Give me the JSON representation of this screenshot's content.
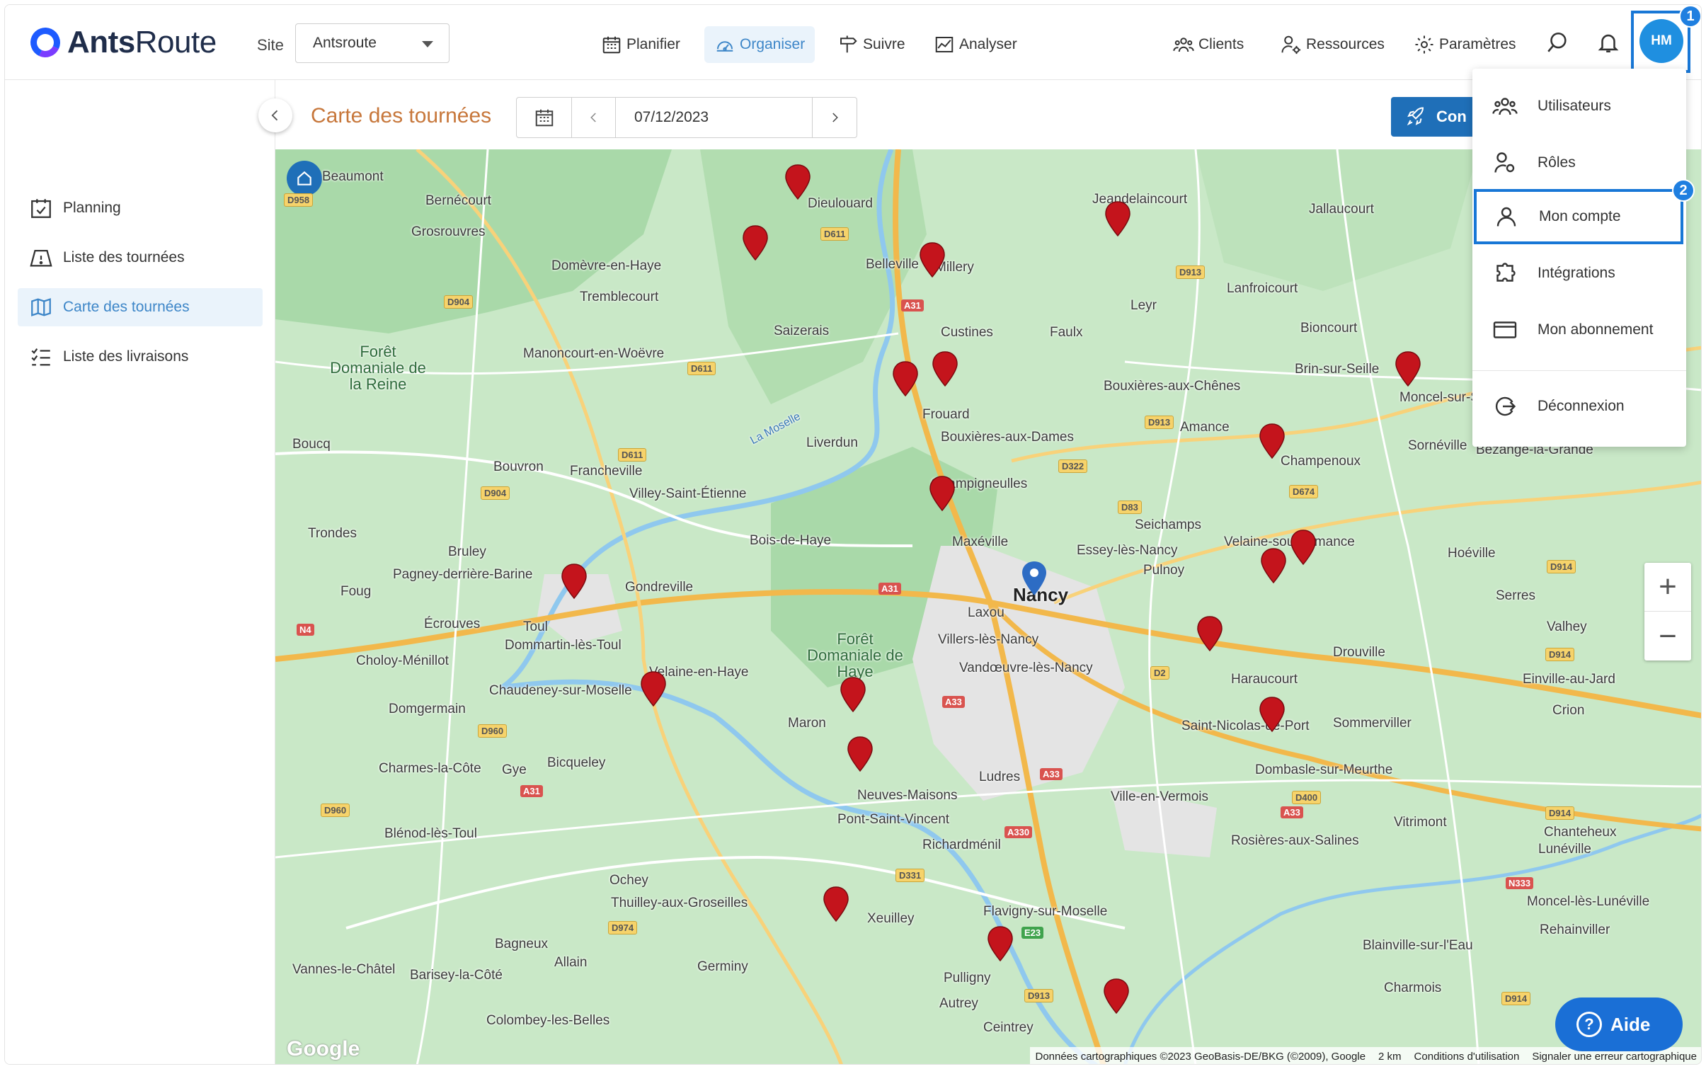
{
  "header": {
    "brand_bold": "Ants",
    "brand_light": "Route",
    "site_label": "Site",
    "site_value": "Antsroute",
    "nav": [
      {
        "label": "Planifier"
      },
      {
        "label": "Organiser"
      },
      {
        "label": "Suivre"
      },
      {
        "label": "Analyser"
      },
      {
        "label": "Clients"
      },
      {
        "label": "Ressources"
      },
      {
        "label": "Paramètres"
      }
    ],
    "avatar_initials": "HM",
    "step_1": "1",
    "step_2": "2"
  },
  "sidebar": {
    "items": [
      {
        "label": "Planning",
        "icon": "calendar-check-icon"
      },
      {
        "label": "Liste des tournées",
        "icon": "tent-icon"
      },
      {
        "label": "Carte des tournées",
        "icon": "map-icon"
      },
      {
        "label": "Liste des livraisons",
        "icon": "checklist-icon"
      }
    ]
  },
  "toolbar": {
    "page_title": "Carte des tournées",
    "date": "07/12/2023",
    "primary_button": "Con"
  },
  "dropdown": {
    "items": [
      {
        "label": "Utilisateurs"
      },
      {
        "label": "Rôles"
      },
      {
        "label": "Mon compte"
      },
      {
        "label": "Intégrations"
      },
      {
        "label": "Mon abonnement"
      },
      {
        "label": "Déconnexion"
      }
    ]
  },
  "map": {
    "places": [
      "Beaumont",
      "Bernécourt",
      "Grosrouvres",
      "Dieulouard",
      "Jeandelaincourt",
      "Jallaucourt",
      "Belleville",
      "Millery",
      "Domèvre-en-Haye",
      "Tremblecourt",
      "Leyr",
      "Lanfroicourt",
      "Saizerais",
      "Custines",
      "Faulx",
      "Bioncourt",
      "Manoncourt-en-Woëvre",
      "Brin-sur-Seille",
      "Moncel-sur-Seille",
      "Frouard",
      "Bouxières-aux-Chênes",
      "Liverdun",
      "Bouxières-aux-Dames",
      "Amance",
      "Sornéville",
      "Bezange-la-Grande",
      "Champigneulles",
      "Champenoux",
      "Bouvron",
      "Francheville",
      "Villey-Saint-Étienne",
      "Seichamps",
      "Bois-de-Haye",
      "Maxéville",
      "Essey-lès-Nancy",
      "Velaine-sous-Amance",
      "Hoéville",
      "Trondes",
      "Bruley",
      "Pulnoy",
      "Pagney-derrière-Barine",
      "Gondreville",
      "Nancy",
      "Foug",
      "Laxou",
      "Serres",
      "Écrouves",
      "Toul",
      "Villers-lès-Nancy",
      "Valhey",
      "Dommartin-lès-Toul",
      "Drouville",
      "Choloy-Ménillot",
      "Velaine-en-Haye",
      "Vandœuvre-lès-Nancy",
      "Haraucourt",
      "Einville-au-Jard",
      "Chaudeney-sur-Moselle",
      "Domgermain",
      "Maron",
      "Saint-Nicolas-de-Port",
      "Sommerviller",
      "Crion",
      "Charmes-la-Côte",
      "Gye",
      "Bicqueley",
      "Ludres",
      "Dombasle-sur-Meurthe",
      "Neuves-Maisons",
      "Ville-en-Vermois",
      "Pont-Saint-Vincent",
      "Vitrimont",
      "Chanteheux",
      "Blénod-lès-Toul",
      "Richardménil",
      "Rosières-aux-Salines",
      "Lunéville",
      "Ochey",
      "Thuilley-aux-Groseilles",
      "Moncel-lès-Lunéville",
      "Xeuilley",
      "Flavigny-sur-Moselle",
      "Rehainviller",
      "Bagneux",
      "Allain",
      "Blainville-sur-l'Eau",
      "Vannes-le-Châtel",
      "Barisey-la-Côté",
      "Germiny",
      "Pulligny",
      "Charmois",
      "Autrey",
      "Colombey-les-Belles",
      "Ceintrey",
      "Boucq"
    ],
    "forests": [
      "Forêt Domaniale de la Reine",
      "Forêt Domaniale de Haye"
    ],
    "river": "La Moselle",
    "attribution": "Données cartographiques ©2023 GeoBasis-DE/BKG (©2009), Google",
    "scale": "2 km",
    "terms": "Conditions d'utilisation",
    "report": "Signaler une erreur cartographique",
    "google": "Google",
    "help": "Aide"
  },
  "colors": {
    "accent": "#3d86c8",
    "title": "#c7773b",
    "pin": "#c4141c",
    "avatar": "#1f8fe0"
  }
}
